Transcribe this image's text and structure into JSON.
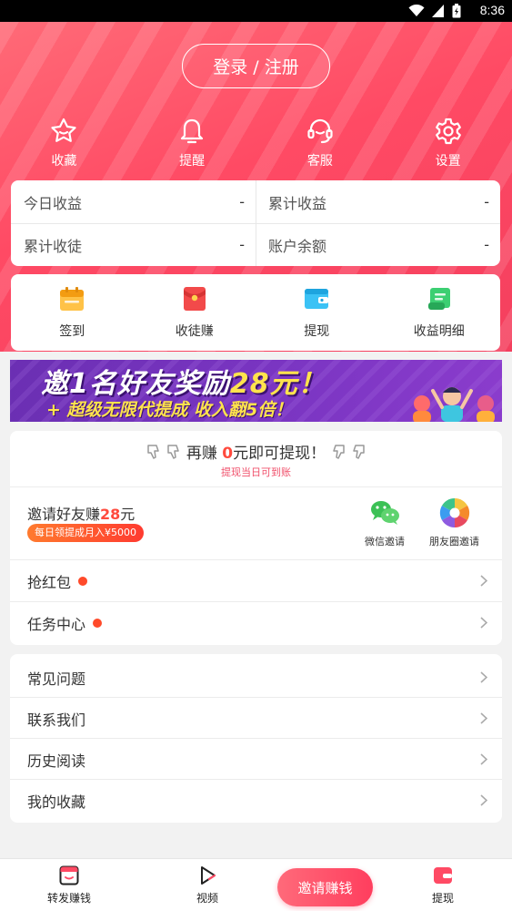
{
  "status_bar": {
    "time": "8:36"
  },
  "header": {
    "login_label": "登录 / 注册"
  },
  "quick_actions": [
    {
      "label": "收藏",
      "icon": "star-badge-icon"
    },
    {
      "label": "提醒",
      "icon": "bell-icon"
    },
    {
      "label": "客服",
      "icon": "headset-icon"
    },
    {
      "label": "设置",
      "icon": "gear-icon"
    }
  ],
  "stats": {
    "today_income": {
      "label": "今日收益",
      "value": "-"
    },
    "total_income": {
      "label": "累计收益",
      "value": "-"
    },
    "total_apprentices": {
      "label": "累计收徒",
      "value": "-"
    },
    "balance": {
      "label": "账户余额",
      "value": "-"
    }
  },
  "actions": [
    {
      "label": "签到",
      "icon": "calendar-icon",
      "color": "#f7b733"
    },
    {
      "label": "收徒赚",
      "icon": "red-envelope-icon",
      "color": "#f24a4a"
    },
    {
      "label": "提现",
      "icon": "wallet-icon",
      "color": "#27b3f0"
    },
    {
      "label": "收益明细",
      "icon": "scroll-icon",
      "color": "#33c46a"
    }
  ],
  "banner": {
    "line1_prefix": "邀1名好友奖励",
    "line1_amount": "28元！",
    "line2": "+ 超级无限代提成 收入翻5倍！"
  },
  "withdraw": {
    "prefix": "再赚",
    "amount": "0",
    "suffix": "元即可提现！",
    "sub": "提现当日可到账"
  },
  "invite": {
    "title_prefix": "邀请好友赚",
    "title_amount": "28",
    "title_suffix": "元",
    "badge": "每日领提成月入¥5000",
    "wechat_label": "微信邀请",
    "moments_label": "朋友圈邀请"
  },
  "menu1": [
    {
      "label": "抢红包",
      "dot": true
    },
    {
      "label": "任务中心",
      "dot": true
    }
  ],
  "menu2": [
    {
      "label": "常见问题"
    },
    {
      "label": "联系我们"
    },
    {
      "label": "历史阅读"
    },
    {
      "label": "我的收藏"
    }
  ],
  "tabbar": {
    "tab1": "转发赚钱",
    "tab2": "视频",
    "center": "邀请赚钱",
    "tab4": "提现"
  },
  "colors": {
    "accent": "#ff4a64",
    "red_text": "#ff4a3d"
  }
}
